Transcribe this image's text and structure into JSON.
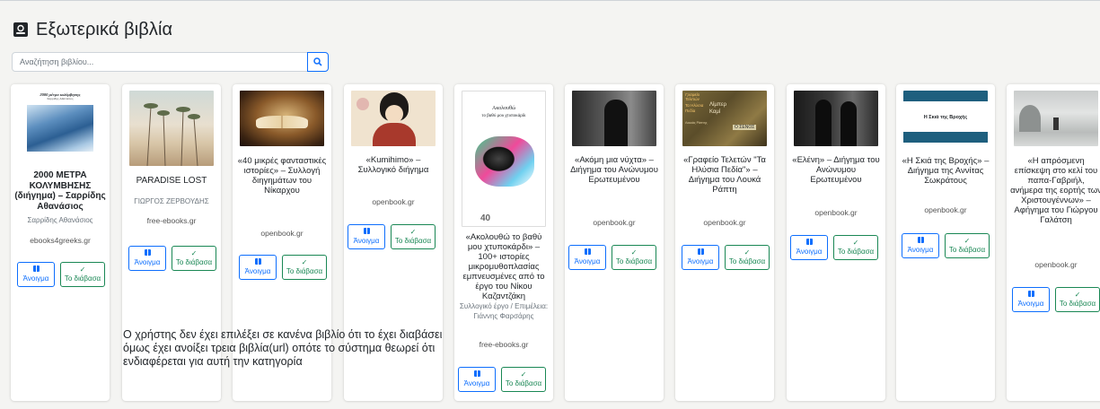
{
  "page": {
    "title": "Εξωτερικά βιβλία",
    "search_placeholder": "Αναζήτηση βιβλίου...",
    "open_label": "Άνοιγμα",
    "read_label": "Το διάβασα"
  },
  "cover_texts": {
    "book1_line1": "2000 μέτρα κολύμβησης",
    "book1_line2": "Σαρρίδης Αθανάσιος",
    "book5_line1": "Ακολουθώ",
    "book5_line2": "το βαθύ μου χτυποκάρδι",
    "book8_line1": "Γραφείο",
    "book8_line2": "Τελετών",
    "book8_line3": "Τα Ηλύσια",
    "book8_line4": "Λίμπερ",
    "book8_line5": "Πεδία",
    "book8_line6": "Καμί",
    "book8_line7": "Λουκάς Ράπτης",
    "book8_line8": "Ο ΣΕΝΟΣ",
    "book9_cover": "Η Σκιά της Βροχής"
  },
  "books": [
    {
      "title": "2000 ΜΕΤΡΑ ΚΟΛΥΜΒΗΣΗΣ (διήγημα) – Σαρρίδης Αθανάσιος",
      "author": "Σαρρίδης Αθανάσιος",
      "source": "ebooks4greeks.gr"
    },
    {
      "title": "PARADISE LOST",
      "author": "ΓΙΩΡΓΟΣ ΖΕΡΒΟΥΔΗΣ",
      "source": "free-ebooks.gr"
    },
    {
      "title": "«40 μικρές φανταστικές ιστορίες» – Συλλογή διηγημάτων του Νίκαρχου",
      "author": "",
      "source": "openbook.gr"
    },
    {
      "title": "«Kumihimo» – Συλλογικό διήγημα",
      "author": "",
      "source": "openbook.gr"
    },
    {
      "title": "«Ακολουθώ το βαθύ μου χτυποκάρδι» – 100+ ιστορίες μικρομυθοπλασίας εμπνευσμένες από το έργο του Νίκου Καζαντζάκη",
      "author": "Συλλογικό έργο / Επιμέλεια: Γιάννης Φαρσάρης",
      "source": "free-ebooks.gr"
    },
    {
      "title": "«Ακόμη μια νύχτα» – Διήγημα του Ανώνυμου Ερωτευμένου",
      "author": "",
      "source": "openbook.gr"
    },
    {
      "title": "«Γραφείο Τελετών \"Τα Ηλύσια Πεδία\"» – Διήγημα του Λουκά Ράπτη",
      "author": "",
      "source": "openbook.gr"
    },
    {
      "title": "«Ελένη» – Διήγημα του Ανώνυμου Ερωτευμένου",
      "author": "",
      "source": "openbook.gr"
    },
    {
      "title": "«Η Σκιά της Βροχής» – Διήγημα της Αννίτας Σωκράτους",
      "author": "",
      "source": "openbook.gr"
    },
    {
      "title": "«Η απρόσμενη επίσκεψη στο κελί του παπα-Γαβριήλ, ανήμερα της εορτής των Χριστουγέννων» – Αφήγημα του Γιώργου Γαλάτση",
      "author": "",
      "source": "openbook.gr"
    }
  ],
  "note": "Ο χρήστης δεν έχει επιλέξει σε κανένα βιβλίο ότι το έχει διαβάσει όμως έχει ανοίξει τρεια βιβλία(url) οπότε το σύστημα θεωρεί ότι ενδιαφέρεται για αυτή την κατηγορία"
}
